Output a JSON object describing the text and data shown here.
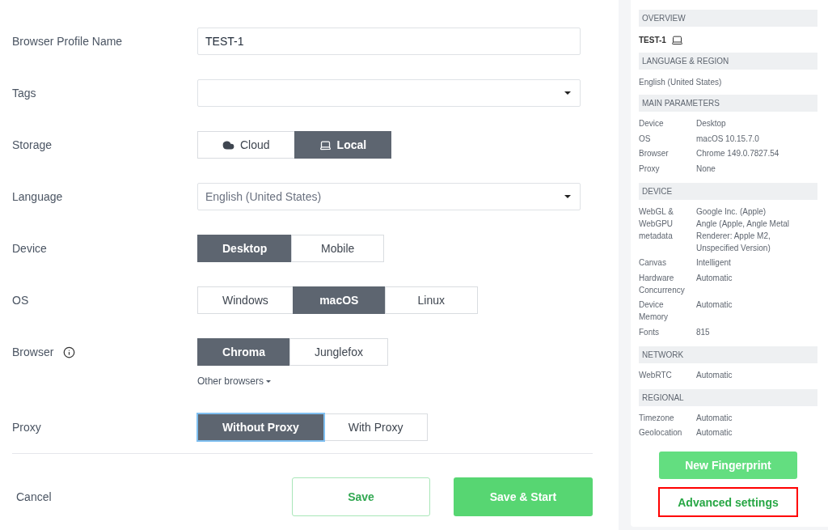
{
  "form": {
    "fields": [
      {
        "kind": "text",
        "label": "Browser Profile Name",
        "value": "TEST-1"
      },
      {
        "kind": "select",
        "label": "Tags"
      },
      {
        "kind": "icon-segmented",
        "label": "Storage",
        "focused": false,
        "options": [
          {
            "label": "Cloud",
            "selected": false
          },
          {
            "label": "Local",
            "selected": true
          }
        ]
      },
      {
        "kind": "select",
        "label": "Language",
        "value": "English (United States)"
      },
      {
        "kind": "segmented",
        "label": "Device",
        "focused": false,
        "options": [
          {
            "label": "Desktop",
            "selected": true
          },
          {
            "label": "Mobile",
            "selected": false
          }
        ]
      },
      {
        "kind": "segmented",
        "label": "OS",
        "focused": false,
        "options": [
          {
            "label": "Windows",
            "selected": false
          },
          {
            "label": "macOS",
            "selected": true
          },
          {
            "label": "Linux",
            "selected": false
          }
        ]
      },
      {
        "kind": "segmented",
        "label": "Browser",
        "info": true,
        "focused": false,
        "options": [
          {
            "label": "Chroma",
            "selected": true
          },
          {
            "label": "Junglefox",
            "selected": false
          }
        ],
        "link": "Other browsers"
      },
      {
        "kind": "segmented",
        "label": "Proxy",
        "focused": true,
        "options": [
          {
            "label": "Without Proxy",
            "selected": true
          },
          {
            "label": "With Proxy",
            "selected": false
          }
        ]
      }
    ]
  },
  "footer": {
    "cancel": "Cancel",
    "save": "Save",
    "save_start": "Save & Start"
  },
  "sidebar": {
    "sections": [
      {
        "title": "OVERVIEW",
        "kind": "profile",
        "name": "TEST-1"
      },
      {
        "title": "LANGUAGE & REGION",
        "kind": "text",
        "text": "English (United States)"
      },
      {
        "title": "MAIN PARAMETERS",
        "kind": "table",
        "rows": [
          {
            "label": "Device",
            "values": [
              "Desktop"
            ]
          },
          {
            "label": "OS",
            "values": [
              "macOS 10.15.7.0"
            ]
          },
          {
            "label": "Browser",
            "values": [
              "Chrome 149.0.7827.54"
            ]
          },
          {
            "label": "Proxy",
            "values": [
              "None"
            ]
          }
        ]
      },
      {
        "title": "DEVICE",
        "kind": "table",
        "rows": [
          {
            "label": "WebGL & WebGPU metadata",
            "values": [
              "Google Inc. (Apple)",
              "Angle (Apple, Angle Metal Renderer: Apple M2, Unspecified Version)"
            ]
          },
          {
            "label": "Canvas",
            "values": [
              "Intelligent"
            ]
          },
          {
            "label": "Hardware Concurrency",
            "values": [
              "Automatic"
            ]
          },
          {
            "label": "Device Memory",
            "values": [
              "Automatic"
            ]
          },
          {
            "label": "Fonts",
            "values": [
              "815"
            ]
          }
        ]
      },
      {
        "title": "NETWORK",
        "kind": "table",
        "rows": [
          {
            "label": "WebRTC",
            "values": [
              "Automatic"
            ]
          }
        ]
      },
      {
        "title": "REGIONAL",
        "kind": "table",
        "rows": [
          {
            "label": "Timezone",
            "values": [
              "Automatic"
            ]
          },
          {
            "label": "Geolocation",
            "values": [
              "Automatic"
            ]
          }
        ]
      }
    ],
    "new_fingerprint": "New Fingerprint",
    "advanced_settings": {
      "label": "Advanced settings",
      "highlighted": true
    }
  }
}
